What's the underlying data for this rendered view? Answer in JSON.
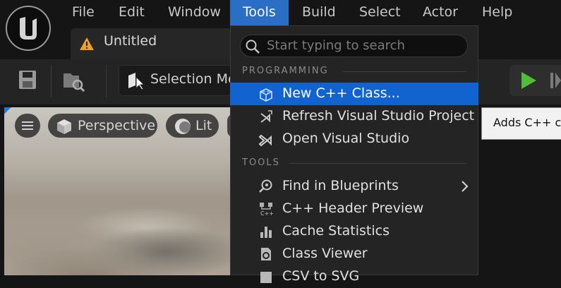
{
  "menubar": {
    "items": [
      "File",
      "Edit",
      "Window",
      "Tools",
      "Build",
      "Select",
      "Actor",
      "Help"
    ],
    "active": "Tools"
  },
  "tab": {
    "title": "Untitled"
  },
  "toolbar": {
    "mode_label": "Selection Mo"
  },
  "viewport": {
    "view_label": "Perspective",
    "lit_label": "Lit"
  },
  "tools_menu": {
    "search_placeholder": "Start typing to search",
    "sections": [
      {
        "label": "PROGRAMMING",
        "items": [
          {
            "label": "New C++ Class...",
            "icon": "cpp-class-icon",
            "highlighted": true
          },
          {
            "label": "Refresh Visual Studio Project",
            "icon": "visual-studio-refresh-icon"
          },
          {
            "label": "Open Visual Studio",
            "icon": "visual-studio-icon"
          }
        ]
      },
      {
        "label": "TOOLS",
        "items": [
          {
            "label": "Find in Blueprints",
            "icon": "find-blueprint-icon",
            "submenu": true
          },
          {
            "label": "C++ Header Preview",
            "icon": "cpp-header-icon"
          },
          {
            "label": "Cache Statistics",
            "icon": "bar-chart-icon"
          },
          {
            "label": "Class Viewer",
            "icon": "class-viewer-icon"
          },
          {
            "label": "CSV to SVG",
            "icon": "csv-icon"
          }
        ]
      }
    ]
  },
  "tooltip": {
    "text": "Adds C++ co"
  },
  "colors": {
    "accent": "#1164cf",
    "menu_active": "#2a6ec6",
    "play_green": "#4fbf3a",
    "warning_orange": "#f0a020"
  }
}
